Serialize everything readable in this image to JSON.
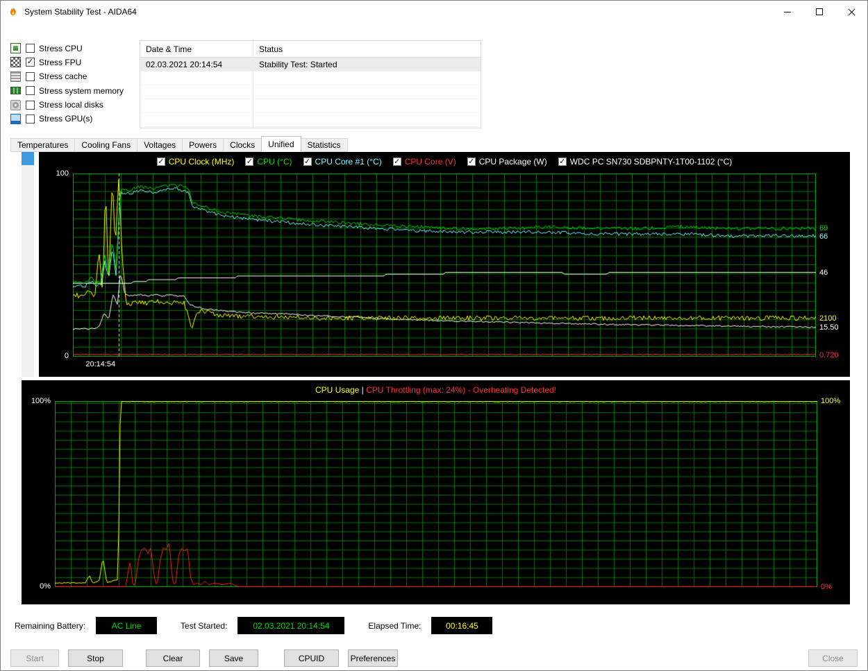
{
  "window": {
    "title": "System Stability Test - AIDA64"
  },
  "stress_options": [
    {
      "label": "Stress CPU",
      "checked": false,
      "icon": "cpu-icon"
    },
    {
      "label": "Stress FPU",
      "checked": true,
      "icon": "fpu-icon"
    },
    {
      "label": "Stress cache",
      "checked": false,
      "icon": "cache-icon"
    },
    {
      "label": "Stress system memory",
      "checked": false,
      "icon": "memory-icon"
    },
    {
      "label": "Stress local disks",
      "checked": false,
      "icon": "disk-icon"
    },
    {
      "label": "Stress GPU(s)",
      "checked": false,
      "icon": "gpu-icon"
    }
  ],
  "log_table": {
    "columns": [
      "Date & Time",
      "Status"
    ],
    "rows": [
      {
        "datetime": "02.03.2021 20:14:54",
        "status": "Stability Test: Started"
      }
    ],
    "empty_row_count": 4
  },
  "tabs": {
    "items": [
      "Temperatures",
      "Cooling Fans",
      "Voltages",
      "Powers",
      "Clocks",
      "Unified",
      "Statistics"
    ],
    "active": "Unified"
  },
  "chart_data": [
    {
      "type": "line",
      "title": "Unified sensor graph",
      "ylim": [
        0,
        100
      ],
      "background": "#000000",
      "grid_color": "#007600",
      "border_color": "#00b400",
      "marker_x": 6.2,
      "x_tick_label": "20:14:54",
      "axis_labels": {
        "top": "100",
        "bottom": "0"
      },
      "legend": [
        {
          "label": "CPU Clock (MHz)",
          "color": "#ffff00",
          "checked": true
        },
        {
          "label": "CPU (°C)",
          "color": "#00dc00",
          "checked": true
        },
        {
          "label": "CPU Core #1 (°C)",
          "color": "#7dffff",
          "checked": true
        },
        {
          "label": "CPU Core (V)",
          "color": "#ff3232",
          "checked": true
        },
        {
          "label": "CPU Package (W)",
          "color": "#ffffff",
          "checked": true
        },
        {
          "label": "WDC PC SN730 SDBPNTY-1T00-1102 (°C)",
          "color": "#ffffff",
          "checked": true
        }
      ],
      "right_labels": [
        {
          "text": "69",
          "color": "#00dc00",
          "y": 70
        },
        {
          "text": "66",
          "color": "#7dffff",
          "y": 65.5
        },
        {
          "text": "46",
          "color": "#ffffff",
          "y": 46
        },
        {
          "text": "2100",
          "color": "#ffff00",
          "y": 21
        },
        {
          "text": "15.50",
          "color": "#ffffff",
          "y": 16
        },
        {
          "text": "0.720",
          "color": "#ff3232",
          "y": 0.8
        }
      ],
      "series": [
        {
          "name": "CPU Core (V)",
          "color": "#ff3232",
          "noise": 0.2,
          "points": [
            [
              0,
              1
            ],
            [
              100,
              1
            ]
          ]
        },
        {
          "name": "CPU Package (W)",
          "color": "#ffffff",
          "noise": 0.4,
          "points": [
            [
              0,
              15
            ],
            [
              2,
              15
            ],
            [
              3.5,
              16
            ],
            [
              4.2,
              24
            ],
            [
              4.8,
              20
            ],
            [
              5.4,
              34
            ],
            [
              6,
              28
            ],
            [
              6.4,
              46
            ],
            [
              7,
              34
            ],
            [
              8,
              33
            ],
            [
              9,
              34
            ],
            [
              10,
              33
            ],
            [
              11,
              34
            ],
            [
              12,
              33
            ],
            [
              13,
              34
            ],
            [
              14,
              33
            ],
            [
              15,
              33
            ],
            [
              15.6,
              29
            ],
            [
              16.5,
              27
            ],
            [
              18,
              26
            ],
            [
              20,
              25
            ],
            [
              23,
              24
            ],
            [
              26,
              23.5
            ],
            [
              30,
              23
            ],
            [
              34,
              22
            ],
            [
              38,
              21.5
            ],
            [
              42,
              20.5
            ],
            [
              46,
              20
            ],
            [
              50,
              19.5
            ],
            [
              55,
              19
            ],
            [
              60,
              18.5
            ],
            [
              66,
              18
            ],
            [
              72,
              17.5
            ],
            [
              80,
              17
            ],
            [
              88,
              16.5
            ],
            [
              100,
              16
            ]
          ]
        },
        {
          "name": "WDC PC SN730 SDBPNTY-1T00-1102 (°C)",
          "color": "#ffffff",
          "noise": 0,
          "points": [
            [
              0,
              40
            ],
            [
              7.9,
              40
            ],
            [
              8.1,
              41
            ],
            [
              9.9,
              41
            ],
            [
              10.1,
              42
            ],
            [
              13.9,
              42
            ],
            [
              14.1,
              43
            ],
            [
              21.9,
              43
            ],
            [
              22.1,
              44
            ],
            [
              41.9,
              44
            ],
            [
              42.1,
              45
            ],
            [
              49.9,
              45
            ],
            [
              50.1,
              46
            ],
            [
              65.9,
              46
            ],
            [
              66.1,
              45
            ],
            [
              71.9,
              45
            ],
            [
              72.1,
              46
            ],
            [
              100,
              46
            ]
          ]
        },
        {
          "name": "CPU Clock (MHz)",
          "color": "#ffff00",
          "noise": 1.3,
          "points": [
            [
              0,
              34
            ],
            [
              1,
              33
            ],
            [
              2,
              35
            ],
            [
              3,
              33
            ],
            [
              3.5,
              58
            ],
            [
              4,
              34
            ],
            [
              4.4,
              95
            ],
            [
              4.8,
              38
            ],
            [
              5.3,
              99
            ],
            [
              5.7,
              60
            ],
            [
              6.2,
              100
            ],
            [
              6.6,
              55
            ],
            [
              7.2,
              28
            ],
            [
              8,
              29
            ],
            [
              9,
              30
            ],
            [
              10,
              29
            ],
            [
              11,
              30
            ],
            [
              12,
              30
            ],
            [
              13,
              29
            ],
            [
              14,
              30
            ],
            [
              15,
              29
            ],
            [
              15.5,
              22
            ],
            [
              16,
              14
            ],
            [
              16.6,
              23
            ],
            [
              17.5,
              25
            ],
            [
              19,
              23
            ],
            [
              21,
              22
            ],
            [
              24,
              22
            ],
            [
              28,
              21.5
            ],
            [
              34,
              21
            ],
            [
              100,
              21
            ]
          ]
        },
        {
          "name": "CPU Core #1 (°C)",
          "color": "#7dffff",
          "noise": 0.9,
          "points": [
            [
              0,
              39
            ],
            [
              1.5,
              38
            ],
            [
              2.5,
              41
            ],
            [
              3.2,
              38
            ],
            [
              3.8,
              40
            ],
            [
              4.3,
              52
            ],
            [
              4.8,
              42
            ],
            [
              5.3,
              60
            ],
            [
              5.8,
              45
            ],
            [
              6.4,
              90
            ],
            [
              7.5,
              89
            ],
            [
              9,
              91
            ],
            [
              11,
              90
            ],
            [
              13,
              92
            ],
            [
              15,
              91
            ],
            [
              15.6,
              90
            ],
            [
              16,
              82
            ],
            [
              17,
              81
            ],
            [
              18.5,
              79
            ],
            [
              20,
              77
            ],
            [
              22,
              76
            ],
            [
              24,
              75
            ],
            [
              27,
              74
            ],
            [
              30,
              73
            ],
            [
              33,
              72
            ],
            [
              37,
              71
            ],
            [
              41,
              70
            ],
            [
              46,
              69
            ],
            [
              52,
              68
            ],
            [
              58,
              68
            ],
            [
              64,
              68
            ],
            [
              70,
              67
            ],
            [
              76,
              67
            ],
            [
              82,
              67
            ],
            [
              88,
              66
            ],
            [
              94,
              66
            ],
            [
              100,
              66
            ]
          ]
        },
        {
          "name": "CPU (°C)",
          "color": "#00dc00",
          "noise": 0.9,
          "points": [
            [
              0,
              41
            ],
            [
              1.5,
              40
            ],
            [
              2.5,
              43
            ],
            [
              3.2,
              40
            ],
            [
              3.8,
              42
            ],
            [
              4.3,
              56
            ],
            [
              4.8,
              44
            ],
            [
              5.3,
              64
            ],
            [
              5.8,
              47
            ],
            [
              6.4,
              92
            ],
            [
              7.5,
              91
            ],
            [
              9,
              93
            ],
            [
              11,
              92
            ],
            [
              13,
              94
            ],
            [
              15,
              93
            ],
            [
              15.6,
              92
            ],
            [
              16,
              84
            ],
            [
              17,
              83
            ],
            [
              18.5,
              81
            ],
            [
              20,
              79
            ],
            [
              22,
              78
            ],
            [
              24,
              77
            ],
            [
              27,
              76
            ],
            [
              30,
              75
            ],
            [
              33,
              74
            ],
            [
              37,
              73
            ],
            [
              41,
              72
            ],
            [
              46,
              71
            ],
            [
              52,
              70
            ],
            [
              58,
              70
            ],
            [
              64,
              71
            ],
            [
              70,
              70
            ],
            [
              76,
              70
            ],
            [
              82,
              71
            ],
            [
              88,
              70
            ],
            [
              94,
              70
            ],
            [
              100,
              70
            ]
          ]
        }
      ]
    },
    {
      "type": "line",
      "title_parts": [
        {
          "text": "CPU Usage",
          "color": "#ffff00"
        },
        {
          "text": "  |  ",
          "color": "#ffffff"
        },
        {
          "text": "CPU Throttling (max: 24%) - Overheating Detected!",
          "color": "#ff3030"
        }
      ],
      "ylim": [
        0,
        100
      ],
      "background": "#000000",
      "grid_color": "#007600",
      "border_color": "#00b400",
      "axis_labels": {
        "top": "100%",
        "bottom": "0%"
      },
      "right_labels": [
        {
          "text": "100%",
          "color": "#ffff00",
          "y": 100
        },
        {
          "text": "0%",
          "color": "#ff3030",
          "y": 0
        }
      ],
      "series": [
        {
          "name": "CPU Usage (%)",
          "color": "#ffff00",
          "noise": 0.3,
          "points": [
            [
              0,
              2
            ],
            [
              4,
              2
            ],
            [
              4.5,
              6
            ],
            [
              5,
              2
            ],
            [
              5.8,
              3
            ],
            [
              6.3,
              16
            ],
            [
              6.8,
              2
            ],
            [
              7.5,
              3
            ],
            [
              8.3,
              4
            ],
            [
              8.6,
              100
            ],
            [
              100,
              100
            ]
          ]
        },
        {
          "name": "CPU Throttling (%)",
          "color": "#ff2020",
          "noise": 0,
          "points": [
            [
              0,
              0
            ],
            [
              9.3,
              0
            ],
            [
              9.6,
              8
            ],
            [
              9.9,
              14
            ],
            [
              10.2,
              2
            ],
            [
              10.5,
              0
            ],
            [
              11,
              16
            ],
            [
              11.4,
              20
            ],
            [
              11.8,
              21
            ],
            [
              12.2,
              18
            ],
            [
              12.6,
              21
            ],
            [
              13,
              6
            ],
            [
              13.4,
              0
            ],
            [
              13.8,
              14
            ],
            [
              14.2,
              21
            ],
            [
              14.6,
              20
            ],
            [
              15,
              24
            ],
            [
              15.4,
              4
            ],
            [
              15.8,
              0
            ],
            [
              16.2,
              16
            ],
            [
              16.6,
              21
            ],
            [
              17,
              19
            ],
            [
              17.4,
              21
            ],
            [
              17.8,
              5
            ],
            [
              18.2,
              1
            ],
            [
              18.7,
              2
            ],
            [
              19.2,
              1
            ],
            [
              19.7,
              3
            ],
            [
              20.2,
              1
            ],
            [
              21,
              2
            ],
            [
              22,
              1
            ],
            [
              23,
              2
            ],
            [
              24,
              0
            ],
            [
              100,
              0
            ]
          ]
        }
      ]
    }
  ],
  "footer": {
    "battery_label": "Remaining Battery:",
    "battery_value": "AC Line",
    "battery_color": "#00dc00",
    "test_started_label": "Test Started:",
    "test_started_value": "02.03.2021 20:14:54",
    "test_started_color": "#00dc00",
    "elapsed_label": "Elapsed Time:",
    "elapsed_value": "00:16:45",
    "elapsed_color": "#ffff00"
  },
  "action_buttons": [
    {
      "label": "Start",
      "enabled": false
    },
    {
      "label": "Stop",
      "enabled": true
    },
    {
      "label": "Clear",
      "enabled": true
    },
    {
      "label": "Save",
      "enabled": true
    },
    {
      "label": "CPUID",
      "enabled": true
    },
    {
      "label": "Preferences",
      "enabled": true
    },
    {
      "label": "Close",
      "enabled": false
    }
  ]
}
